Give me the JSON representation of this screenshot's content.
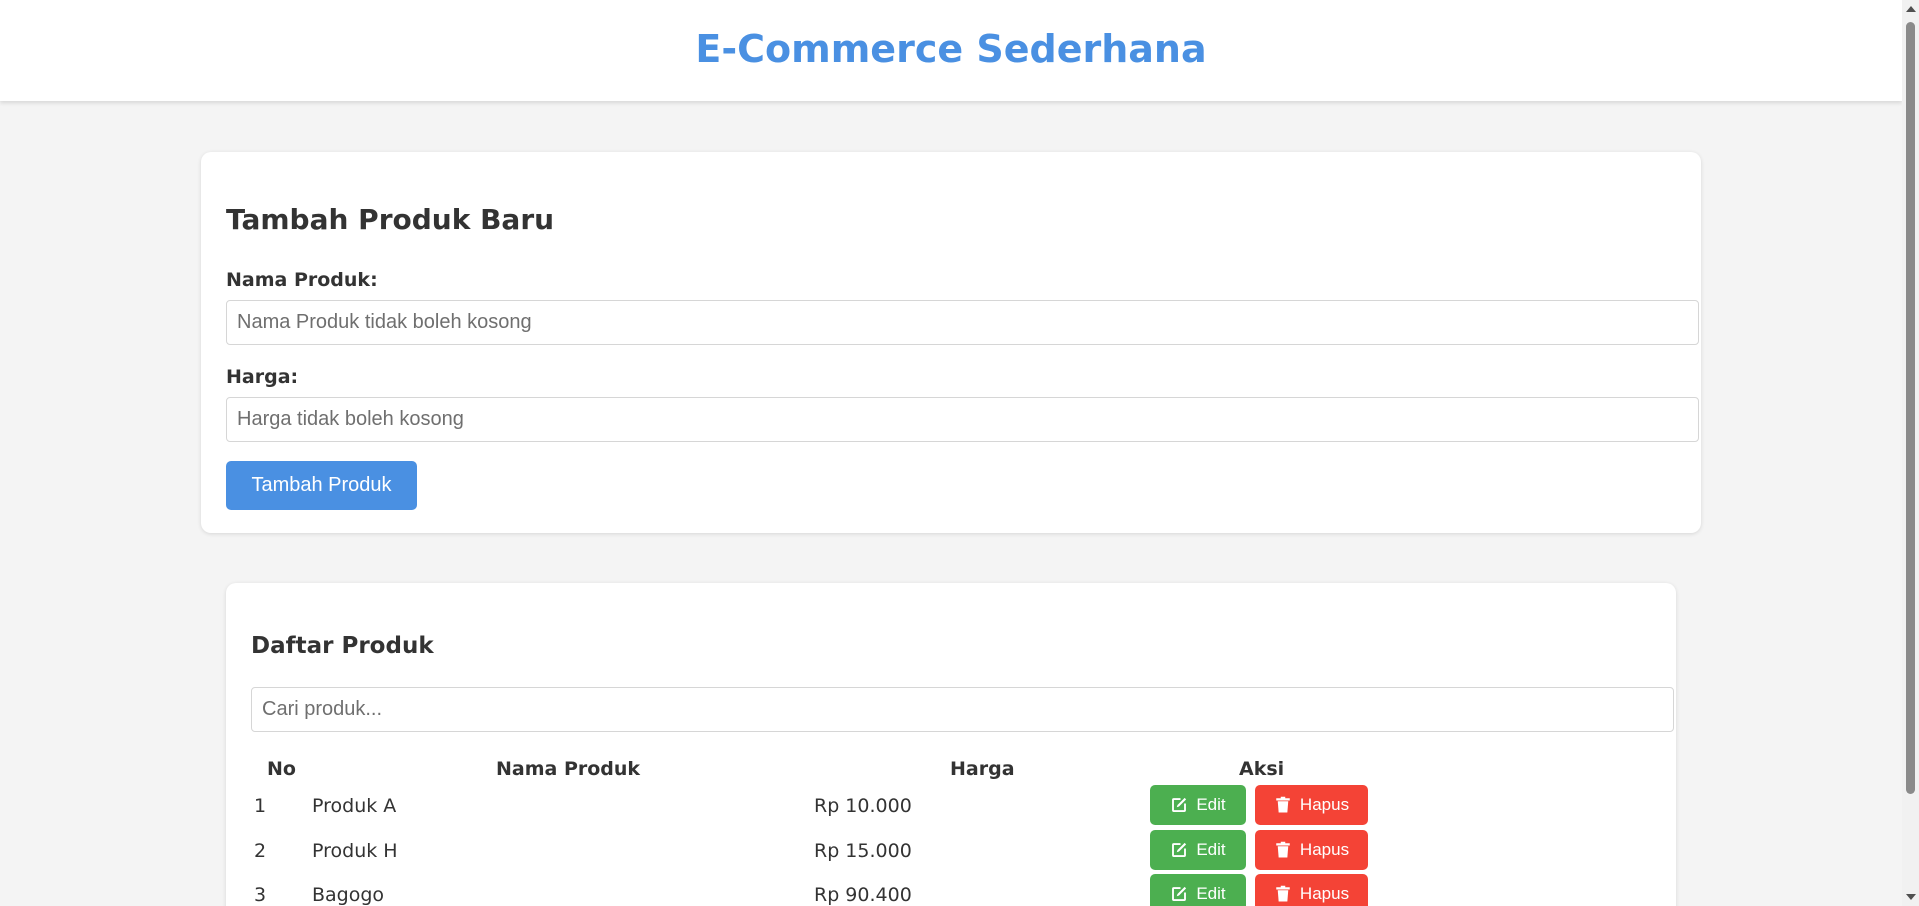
{
  "header": {
    "title": "E-Commerce Sederhana"
  },
  "form": {
    "title": "Tambah Produk Baru",
    "name_label": "Nama Produk:",
    "name_placeholder": "Nama Produk tidak boleh kosong",
    "name_value": "",
    "price_label": "Harga:",
    "price_placeholder": "Harga tidak boleh kosong",
    "price_value": "",
    "submit_label": "Tambah Produk"
  },
  "list": {
    "title": "Daftar Produk",
    "search_placeholder": "Cari produk...",
    "search_value": "",
    "columns": {
      "no": "No",
      "name": "Nama Produk",
      "price": "Harga",
      "actions": "Aksi"
    },
    "rows": [
      {
        "no": "1",
        "name": "Produk A",
        "price": "Rp 10.000",
        "edit": "Edit",
        "delete": "Hapus"
      },
      {
        "no": "2",
        "name": "Produk H",
        "price": "Rp 15.000",
        "edit": "Edit",
        "delete": "Hapus"
      },
      {
        "no": "3",
        "name": "Bagogo",
        "price": "Rp 90.400",
        "edit": "Edit",
        "delete": "Hapus"
      }
    ]
  },
  "colors": {
    "accent": "#4a90e2",
    "edit": "#4caf50",
    "delete": "#f44336",
    "background": "#f4f4f4"
  },
  "icons": {
    "edit": "edit-icon",
    "delete": "trash-icon"
  }
}
